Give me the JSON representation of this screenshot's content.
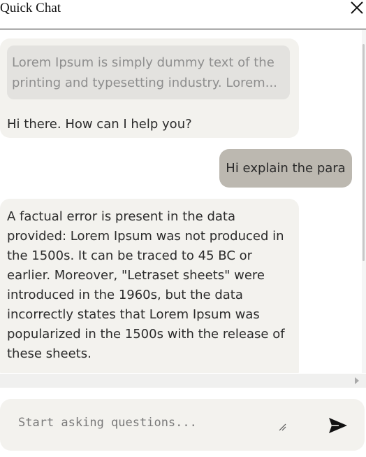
{
  "header": {
    "title": "Quick Chat"
  },
  "messages": [
    {
      "role": "assistant",
      "quoted_text": "Lorem Ipsum is simply dummy text of the printing and typesetting industry. Lorem...",
      "text": "Hi there. How can I help you?"
    },
    {
      "role": "user",
      "text": "Hi explain the para"
    },
    {
      "role": "assistant",
      "text": "A factual error is present in the data provided: Lorem Ipsum was not produced in the 1500s. It can be traced to 45 BC or earlier. Moreover, \"Letraset sheets\" were introduced in the 1960s, but the data incorrectly states that Lorem Ipsum was popularized in the 1500s with the release of these sheets."
    }
  ],
  "composer": {
    "placeholder": "Start asking questions..."
  },
  "icons": {
    "close": "close-icon",
    "send": "send-icon",
    "resize": "resize-grip-icon"
  },
  "colors": {
    "assistant_bubble": "#f3f2ee",
    "quote_bg": "#e3e2df",
    "user_bubble": "#bcb8b0"
  }
}
